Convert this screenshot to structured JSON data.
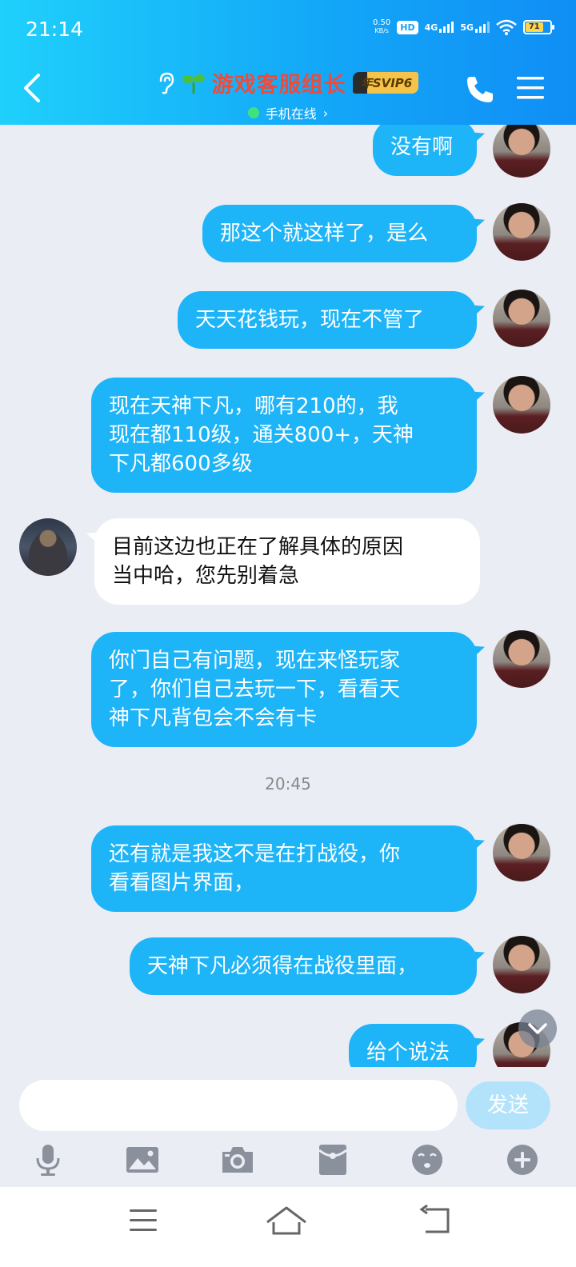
{
  "status_bar": {
    "time": "21:14",
    "net_speed_value": "0.50",
    "net_speed_unit": "KB/s",
    "hd_label": "HD",
    "signal_1": "4G",
    "signal_2": "5G",
    "battery": "71"
  },
  "header": {
    "title": "游戏客服组长",
    "vip_badge": "年SVIP6",
    "status": "手机在线",
    "status_chevron": "›"
  },
  "messages": [
    {
      "side": "me",
      "text": "没有啊"
    },
    {
      "side": "me",
      "text": "那这个就这样了，是么"
    },
    {
      "side": "me",
      "text": "天天花钱玩，现在不管了"
    },
    {
      "side": "me",
      "text": "现在天神下凡，哪有210的，我\n现在都110级，通关800+，天神\n下凡都600多级"
    },
    {
      "side": "other",
      "text": "目前这边也正在了解具体的原因\n当中哈，您先别着急"
    },
    {
      "side": "me",
      "text": "你门自己有问题，现在来怪玩家\n了，你们自己去玩一下，看看天\n神下凡背包会不会有卡"
    },
    {
      "side": "me",
      "text": "还有就是我这不是在打战役，你\n看看图片界面，"
    },
    {
      "side": "me",
      "text": "天神下凡必须得在战役里面，"
    },
    {
      "side": "me",
      "text": "给个说法"
    }
  ],
  "timestamp": "20:45",
  "input": {
    "value": "",
    "placeholder": "",
    "send_label": "发送"
  },
  "toolbar_icons": [
    "microphone-icon",
    "image-icon",
    "camera-icon",
    "red-packet-icon",
    "emoji-icon",
    "plus-icon"
  ],
  "colors": {
    "header_start": "#1fd0fb",
    "header_end": "#108ef5",
    "my_bubble": "#1eb4f8",
    "other_bubble": "#ffffff",
    "title_red": "#f04a3a",
    "background": "#ebedf5"
  }
}
